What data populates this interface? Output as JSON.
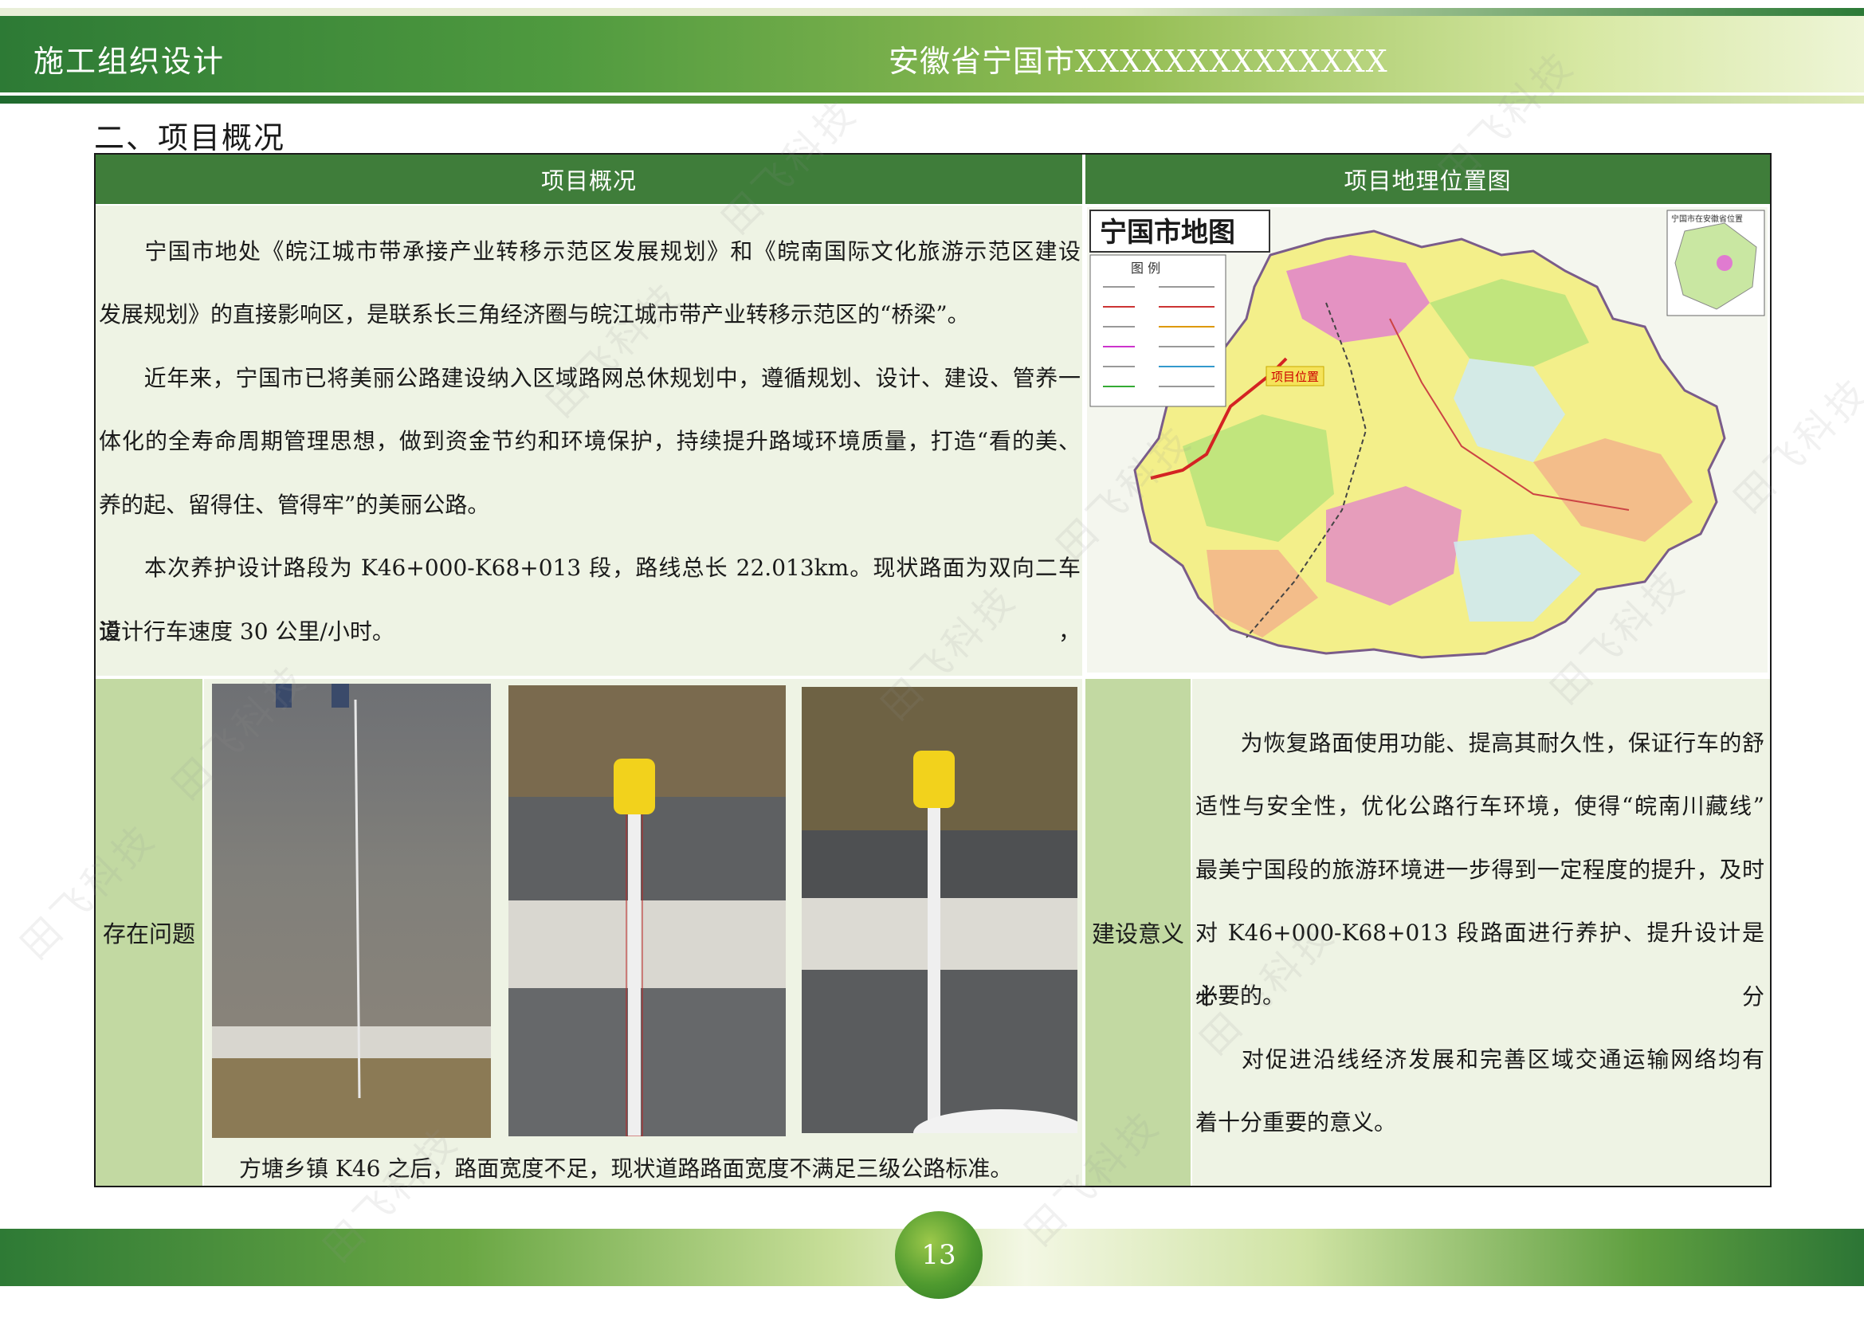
{
  "header": {
    "left_title": "施工组织设计",
    "right_title": "安徽省宁国市XXXXXXXXXXXXXX"
  },
  "section_title": "二、项目概况",
  "table": {
    "col1_header": "项目概况",
    "col2_header": "项目地理位置图",
    "overview_paragraphs": [
      "宁国市地处《皖江城市带承接产业转移示范区发展规划》和《皖南国际文化旅游示范区建设",
      "发展规划》的直接影响区，是联系长三角经济圈与皖江城市带产业转移示范区的“桥梁”。",
      "近年来，宁国市已将美丽公路建设纳入区域路网总休规划中，遵循规划、设计、建设、管养一",
      "体化的全寿命周期管理思想，做到资金节约和环境保护，持续提升路域环境质量，打造“看的美、",
      "养的起、留得住、管得牢”的美丽公路。",
      "本次养护设计路段为 K46+000-K68+013 段，路线总长 22.013km。现状路面为双向二车道，",
      "设计行车速度 30 公里/小时。"
    ],
    "map": {
      "title": "宁国市地图",
      "legend_title": "图 例",
      "project_marker": "项目位置",
      "inset_label": "宁国市在安徽省位置"
    },
    "problem_label": "存在问题",
    "problem_caption": "方塘乡镇 K46 之后，路面宽度不足，现状道路路面宽度不满足三级公路标准。",
    "significance_label": "建设意义",
    "significance_lines": [
      "为恢复路面使用功能、提高其耐久性，保证行车的舒",
      "适性与安全性，优化公路行车环境，使得“皖南川藏线”",
      "最美宁国段的旅游环境进一步得到一定程度的提升，及时",
      "对 K46+000-K68+013  段路面进行养护、提升设计是十分",
      "必要的。",
      "对促进沿线经济发展和完善区域交通运输网络均有",
      "着十分重要的意义。"
    ]
  },
  "footer": {
    "page_number": "13"
  },
  "watermark": "田飞科技",
  "colors": {
    "header_green": "#3f7d3a",
    "panel_bg": "#eef3e4",
    "label_bg": "#c2d9a2"
  }
}
